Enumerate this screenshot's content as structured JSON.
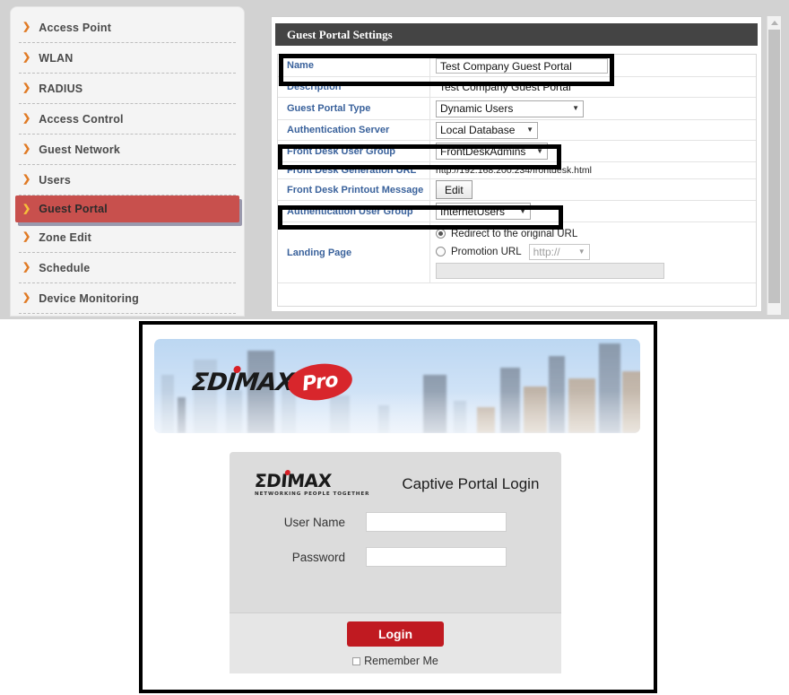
{
  "sidebar": {
    "items": [
      {
        "label": "Access Point",
        "active": false
      },
      {
        "label": "WLAN",
        "active": false
      },
      {
        "label": "RADIUS",
        "active": false
      },
      {
        "label": "Access Control",
        "active": false
      },
      {
        "label": "Guest Network",
        "active": false
      },
      {
        "label": "Users",
        "active": false
      },
      {
        "label": "Guest Portal",
        "active": true
      },
      {
        "label": "Zone Edit",
        "active": false
      },
      {
        "label": "Schedule",
        "active": false
      },
      {
        "label": "Device Monitoring",
        "active": false
      }
    ],
    "arrow_glyph": "❯"
  },
  "panel": {
    "title": "Guest Portal Settings",
    "rows": {
      "name": {
        "label": "Name",
        "value": "Test Company Guest Portal"
      },
      "description": {
        "label": "Description",
        "value": "Test Company Guest Portal"
      },
      "guest_portal_type": {
        "label": "Guest Portal Type",
        "value": "Dynamic Users"
      },
      "authentication_server": {
        "label": "Authentication Server",
        "value": "Local Database"
      },
      "front_desk_user_group": {
        "label": "Front Desk User Group",
        "value": "FrontDeskAdmins"
      },
      "front_desk_generation_url": {
        "label": "Front Desk Generation URL",
        "value": "http://192.168.200.234/frontdesk.html"
      },
      "front_desk_printout_message": {
        "label": "Front Desk Printout Message",
        "button": "Edit"
      },
      "authentication_user_group": {
        "label": "Authentication User Group",
        "value": "InternetUsers"
      },
      "landing_page": {
        "label": "Landing Page",
        "option_redirect": "Redirect to the original URL",
        "option_promotion": "Promotion URL",
        "promotion_scheme": "http://",
        "promotion_url_value": "",
        "selected": "redirect"
      }
    },
    "caret_glyph": "▼"
  },
  "scrollbar": {
    "position": "top"
  },
  "portal_preview": {
    "banner": {
      "brand": "ΣDIMAX",
      "sub_brand": "Pro"
    },
    "login_card": {
      "logo": "ΣDIMAX",
      "logo_tagline": "NETWORKING PEOPLE TOGETHER",
      "title": "Captive Portal Login",
      "username_label": "User Name",
      "username_value": "",
      "password_label": "Password",
      "password_value": "",
      "login_button": "Login",
      "remember_label": "Remember Me",
      "remember_checked": false
    }
  },
  "colors": {
    "sidebar_active": "#c8504d",
    "panel_header": "#444444",
    "label_blue": "#39619b",
    "login_button_red": "#c01a21",
    "brand_red": "#d8262c",
    "highlight_box": "#000000"
  }
}
